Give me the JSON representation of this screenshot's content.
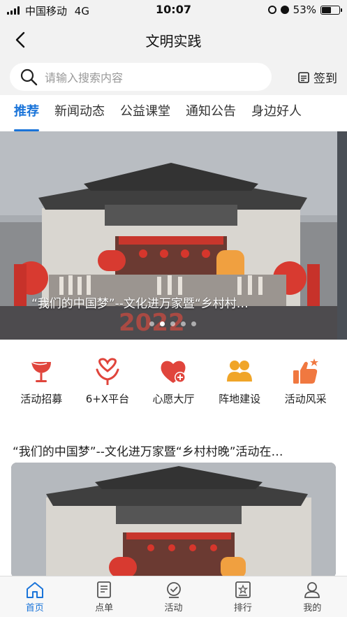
{
  "status_bar": {
    "carrier": "中国移动",
    "network": "4G",
    "time": "10:07",
    "battery_percent": "53%",
    "battery_level": 0.53
  },
  "nav": {
    "title": "文明实践"
  },
  "search": {
    "placeholder": "请输入搜索内容",
    "checkin_label": "签到"
  },
  "tabs": [
    {
      "label": "推荐",
      "active": true
    },
    {
      "label": "新闻动态",
      "active": false
    },
    {
      "label": "公益课堂",
      "active": false
    },
    {
      "label": "通知公告",
      "active": false
    },
    {
      "label": "身边好人",
      "active": false
    }
  ],
  "banner": {
    "caption": "“我们的中国梦”--文化进万家暨“乡村村…",
    "dot_count": 5,
    "active_dot": 1,
    "image_text": "2022"
  },
  "quick_links": [
    {
      "label": "活动招募",
      "icon": "wine-glass-icon",
      "color": "#e0453c"
    },
    {
      "label": "6+X平台",
      "icon": "heart-hands-icon",
      "color": "#e0453c"
    },
    {
      "label": "心愿大厅",
      "icon": "heart-plus-icon",
      "color": "#e0453c"
    },
    {
      "label": "阵地建设",
      "icon": "people-icon",
      "color": "#f0a528"
    },
    {
      "label": "活动风采",
      "icon": "thumbs-up-icon",
      "color": "#f07840"
    }
  ],
  "article": {
    "title": "“我们的中国梦”--文化进万家暨“乡村村晚”活动在…"
  },
  "tabbar": [
    {
      "label": "首页",
      "icon": "home-icon",
      "active": true
    },
    {
      "label": "点单",
      "icon": "document-icon",
      "active": false
    },
    {
      "label": "活动",
      "icon": "check-badge-icon",
      "active": false
    },
    {
      "label": "排行",
      "icon": "ranking-star-icon",
      "active": false
    },
    {
      "label": "我的",
      "icon": "user-icon",
      "active": false
    }
  ],
  "colors": {
    "accent": "#1a74d9",
    "header_bg": "#f2f2f2"
  }
}
